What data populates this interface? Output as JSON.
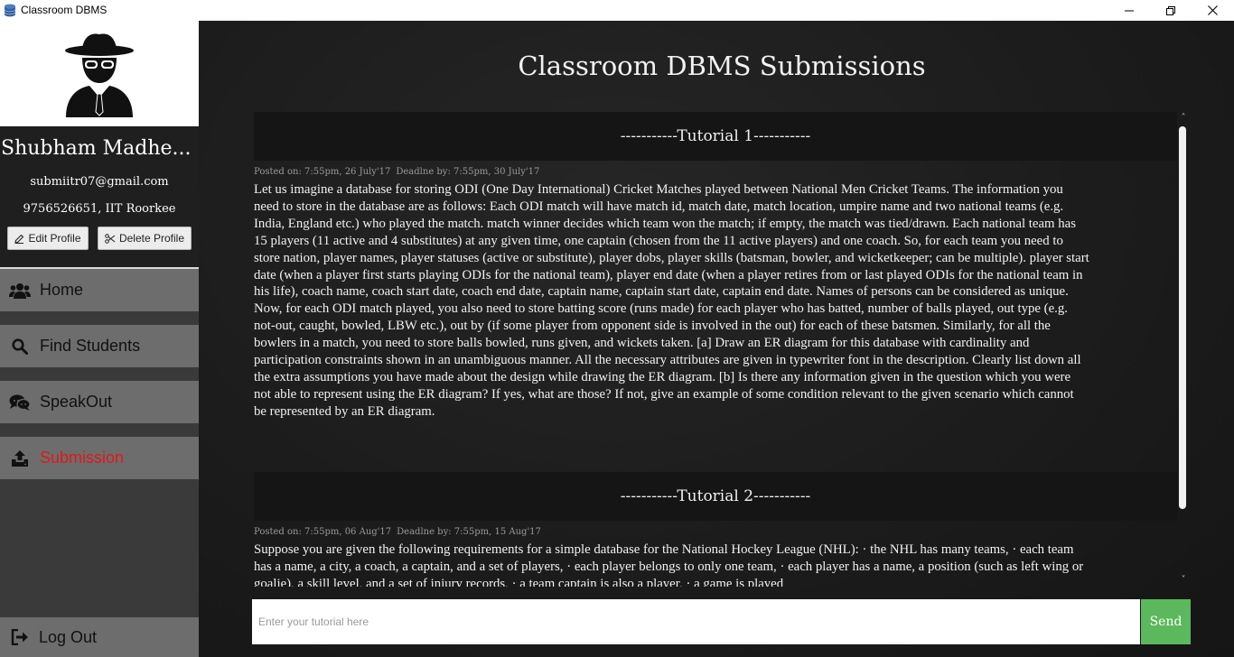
{
  "window": {
    "title": "Classroom DBMS",
    "icons": {
      "app": "database-icon",
      "minimize": "minimize-icon",
      "maximize": "restore-icon",
      "close": "close-icon"
    }
  },
  "profile": {
    "avatar_icon": "spy-avatar-icon",
    "name": "Shubham Madheysia",
    "email": "submiitr07@gmail.com",
    "phone_location": "9756526651,  IIT Roorkee",
    "edit_label": "Edit Profile",
    "delete_label": "Delete Profile"
  },
  "nav": {
    "items": [
      {
        "label": "Home",
        "icon": "users-icon",
        "active": false
      },
      {
        "label": "Find Students",
        "icon": "search-icon",
        "active": false
      },
      {
        "label": "SpeakOut",
        "icon": "chat-icon",
        "active": false
      },
      {
        "label": "Submission",
        "icon": "upload-icon",
        "active": true
      }
    ],
    "logout_label": "Log Out",
    "active_color": "#e01919"
  },
  "main": {
    "title": "Classroom DBMS Submissions",
    "tutorials": [
      {
        "header": "-----------Tutorial 1-----------",
        "posted": "Posted on: 7:55pm, 26 July'17",
        "deadline": "Deadlne by: 7:55pm, 30 July'17",
        "body": "Let us imagine a database for storing ODI (One Day International) Cricket Matches played between National Men Cricket Teams. The information you need to store in the database are as follows: Each ODI match will have match id, match date, match location, umpire name and two national teams (e.g. India, England etc.) who played the match. match winner decides which team won the match; if empty, the match was tied/drawn. Each national team has 15 players (11 active and 4 substitutes) at any given time, one captain (chosen from the 11 active players) and one coach. So, for each team you need to store nation, player names, player statuses (active or substitute), player dobs, player skills (batsman, bowler, and wicketkeeper; can be multiple). player start date (when a player first starts playing ODIs for the national team), player end date (when a player retires from or last played ODIs for the national team in his life), coach name, coach start date, coach end date, captain name, captain start date, captain end date. Names of persons can be considered as unique. Now, for each ODI match played, you also need to store batting score (runs made) for each player who has batted, number of balls played, out type (e.g. not-out, caught, bowled, LBW etc.), out by (if some player from opponent side is involved in the out) for each of these batsmen. Similarly, for all the bowlers in a match, you need to store balls bowled, runs given, and wickets taken. [a] Draw an ER diagram for this database with cardinality and participation constraints shown in an unambiguous manner. All the necessary attributes are given in typewriter font in the description. Clearly list down all the extra assumptions you have made about the design while drawing the ER diagram. [b] Is there any information given in the question which you were not able to represent using the ER diagram? If yes, what are those? If not, give an example of some condition relevant to the given scenario which cannot be represented by an ER diagram."
      },
      {
        "header": "-----------Tutorial 2-----------",
        "posted": "Posted on: 7:55pm, 06 Aug'17",
        "deadline": "Deadlne by: 7:55pm, 15 Aug'17",
        "body": "Suppose you are given the following requirements for a simple database for the National Hockey League (NHL): · the NHL has many teams, · each team has a name, a city, a coach, a captain, and a set of players, · each player belongs to only one team, · each player has a name, a position (such as left wing or goalie), a skill level, and a set of injury records, · a team captain is also a player, · a game is played"
      }
    ]
  },
  "composer": {
    "placeholder": "Enter your tutorial here",
    "send_label": "Send",
    "send_color": "#5cb85c"
  }
}
